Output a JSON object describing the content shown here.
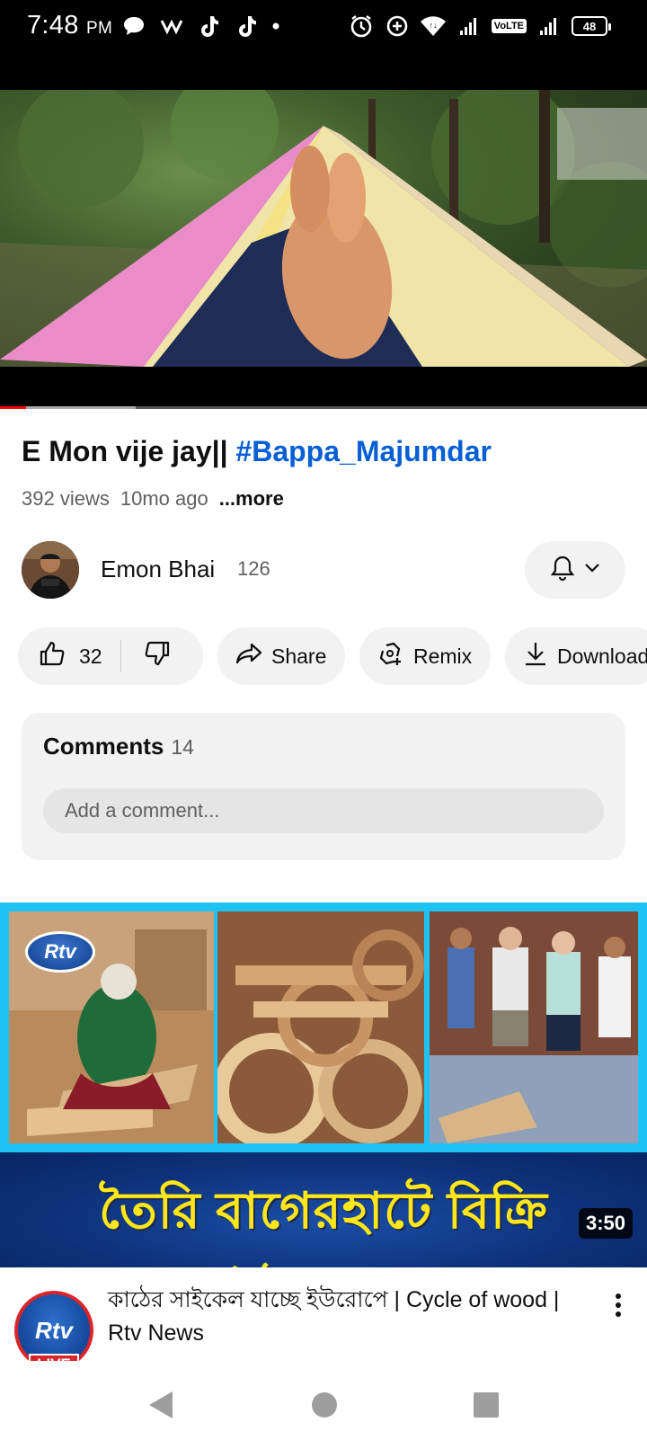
{
  "status_bar": {
    "time": "7:48",
    "ampm": "PM",
    "network": "VoLTE",
    "battery": "48"
  },
  "player": {
    "played_fraction": 0.04,
    "buffered_fraction": 0.21
  },
  "video": {
    "title_plain": "E Mon vije jay|| ",
    "title_hashtag": "#Bappa_Majumdar",
    "views": "392 views",
    "age": "10mo ago",
    "more": "...more"
  },
  "channel": {
    "name": "Emon Bhai",
    "subscribers": "126"
  },
  "actions": {
    "likes": "32",
    "share": "Share",
    "remix": "Remix",
    "download": "Download"
  },
  "comments": {
    "title": "Comments",
    "count": "14",
    "placeholder": "Add a comment..."
  },
  "recommended": {
    "banner_text": "তৈরি বাগেরহাটে বিক্রি ইউরোপে",
    "thumb_logo": "Rtv",
    "duration": "3:50",
    "channel_logo": "Rtv",
    "live_label": "LIVE",
    "title": "কাঠের সাইকেল যাচ্ছে ইউরোপে | Cycle of wood | Rtv News"
  },
  "colors": {
    "accent_red": "#ff0000",
    "hashtag_blue": "#065fd4",
    "banner_yellow": "#ffe61a"
  }
}
